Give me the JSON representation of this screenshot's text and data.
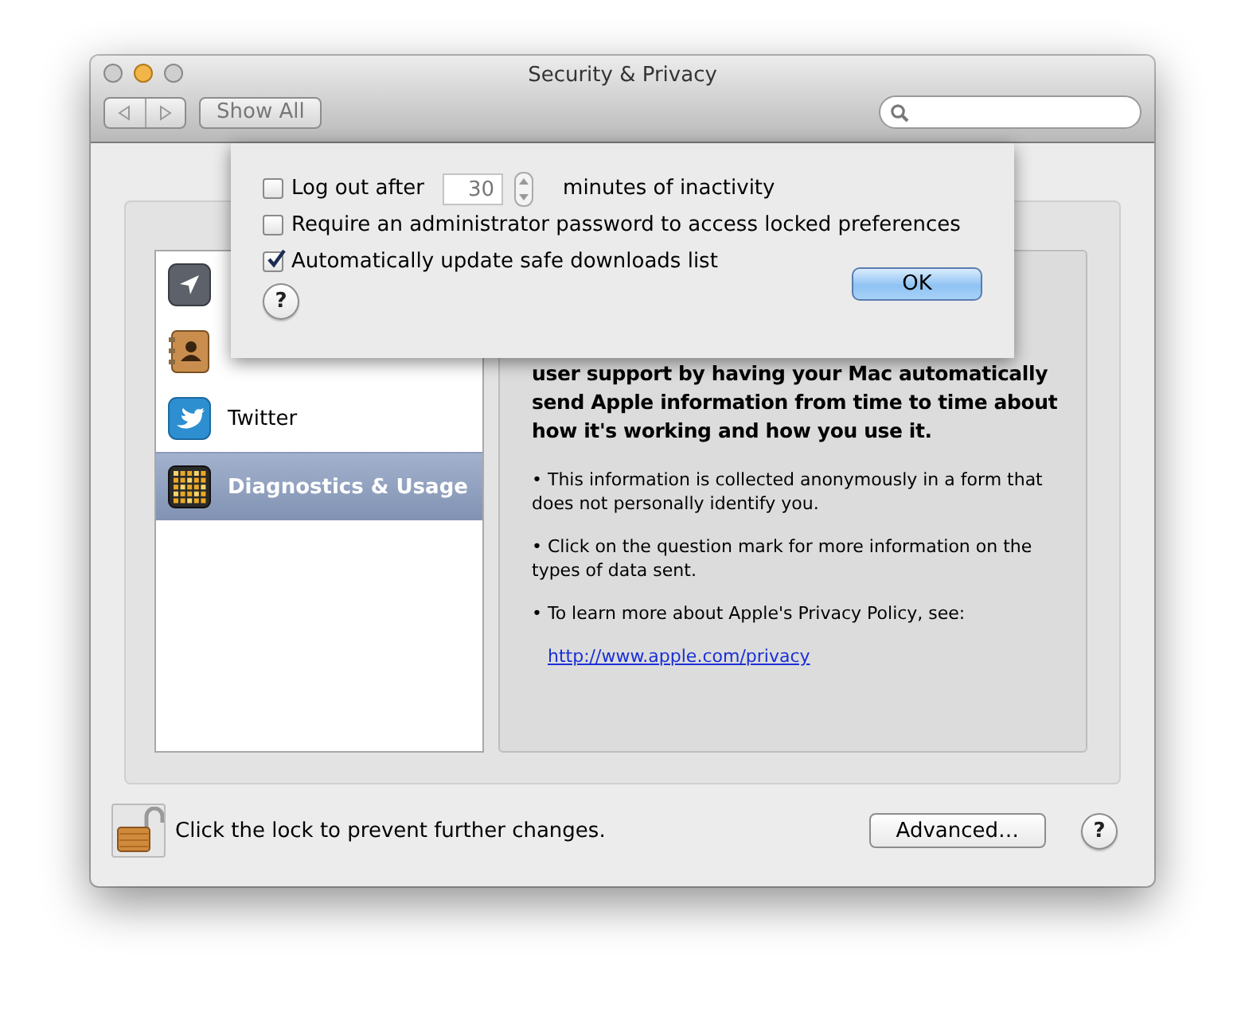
{
  "window": {
    "title": "Security & Privacy"
  },
  "toolbar": {
    "show_all": "Show All"
  },
  "sidebar": {
    "items": [
      {
        "selected": false
      },
      {
        "selected": false
      },
      {
        "label": "Twitter",
        "selected": false
      },
      {
        "label": "Diagnostics & Usage",
        "selected": true
      }
    ]
  },
  "panel": {
    "intro": "user support by having your Mac automatically send Apple information from time to time about how it's working and how you use it.",
    "bullets": [
      "• This information is collected anonymously in a form that does not personally identify you.",
      "• Click on the question mark for more information on the types of data sent.",
      "• To learn more about Apple's Privacy Policy, see:"
    ],
    "link": "http://www.apple.com/privacy"
  },
  "footer": {
    "lock_text": "Click the lock to prevent further changes.",
    "locked": false,
    "advanced": "Advanced…",
    "help": "?"
  },
  "sheet": {
    "options": [
      {
        "kind": "timeout",
        "label": "Log out after",
        "value": "30",
        "suffix": "minutes of inactivity",
        "checked": false
      },
      {
        "kind": "plain",
        "label": "Require an administrator password to access locked preferences",
        "checked": false
      },
      {
        "kind": "plain",
        "label": "Automatically update safe downloads list",
        "checked": true
      }
    ],
    "help": "?",
    "ok": "OK"
  }
}
